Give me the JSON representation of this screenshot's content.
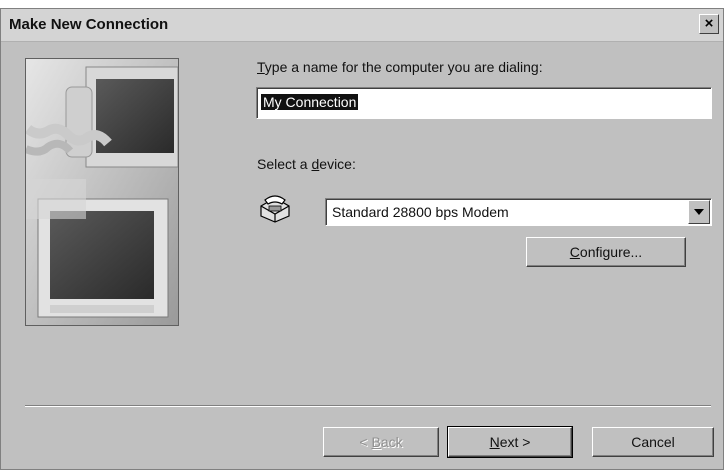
{
  "window": {
    "title": "Make New Connection",
    "close_label": "×"
  },
  "name_section": {
    "label_pre": "",
    "label_underline": "T",
    "label_post": "ype a name for the computer you are dialing:",
    "value": "My Connection"
  },
  "device_section": {
    "label_pre": "Select a ",
    "label_underline": "d",
    "label_post": "evice:",
    "selected": "Standard 28800 bps Modem",
    "configure_pre": "",
    "configure_underline": "C",
    "configure_post": "onfigure..."
  },
  "buttons": {
    "back_pre": "< ",
    "back_underline": "B",
    "back_post": "ack",
    "next_underline": "N",
    "next_post": "ext >",
    "cancel": "Cancel"
  },
  "icons": {
    "illustration": "computers-illustration",
    "device": "telephone-icon",
    "dropdown": "chevron-down-icon"
  }
}
